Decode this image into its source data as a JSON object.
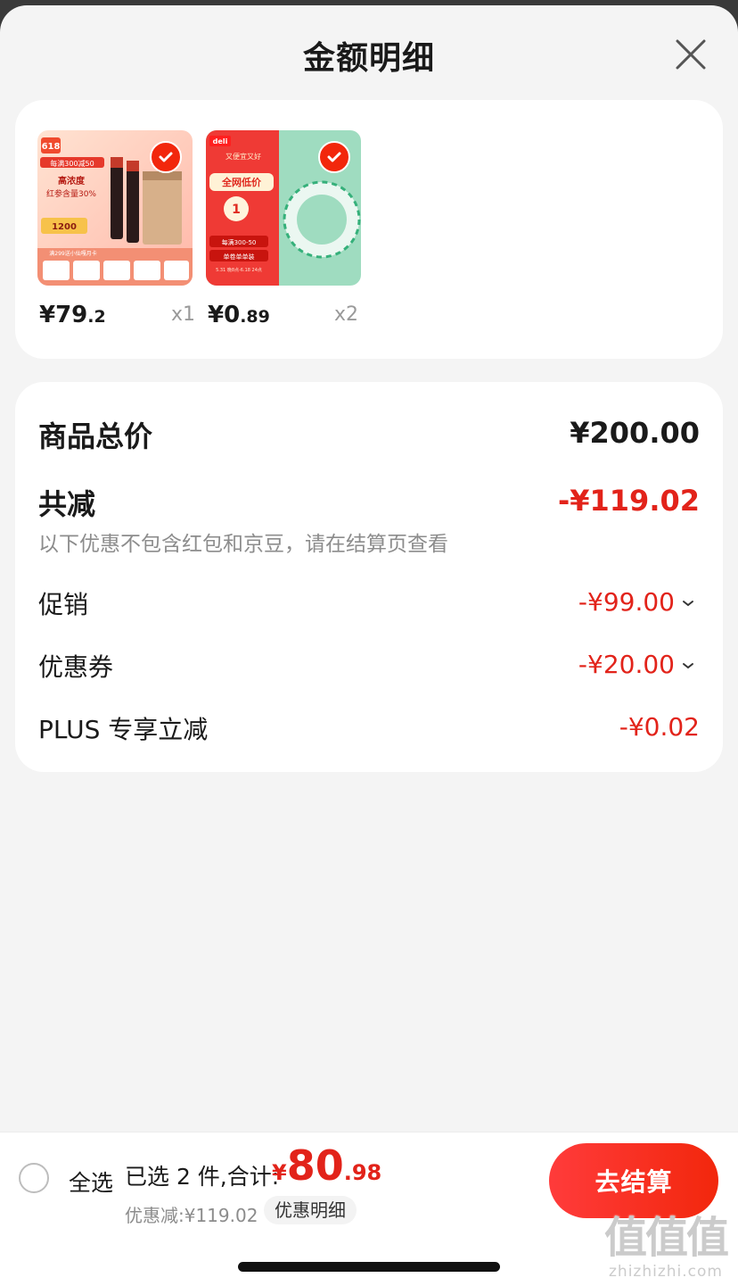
{
  "header": {
    "title": "金额明细",
    "close_icon": "close-icon"
  },
  "products": [
    {
      "price_int": "¥79",
      "price_dec": ".2",
      "quantity": "x1",
      "selected": true,
      "thumb_texts": {
        "badge": "618",
        "promo": "每满300减50",
        "line1": "高浓度",
        "line2": "红参含量30%",
        "price": "1200",
        "bottom": "满299送小仙嘎月卡"
      }
    },
    {
      "price_int": "¥0",
      "price_dec": ".89",
      "quantity": "x2",
      "selected": true,
      "thumb_texts": {
        "brand": "deli",
        "tagline": "又便宜又好",
        "headline": "全网低价",
        "number": "1",
        "promo": "每满300-50",
        "sub": "单卷单单装",
        "date": "5.31 晚8点-6.18 24点"
      }
    }
  ],
  "summary": {
    "total_label": "商品总价",
    "total_value": "¥200.00",
    "reduce_label": "共减",
    "reduce_value": "-¥119.02",
    "note": "以下优惠不包含红包和京豆，请在结算页查看",
    "promo_label": "促销",
    "promo_value": "-¥99.00",
    "coupon_label": "优惠券",
    "coupon_value": "-¥20.00",
    "plus_label": "PLUS 专享立减",
    "plus_value": "-¥0.02"
  },
  "footer": {
    "select_all": "全选",
    "selected_text": "已选 2 件,合计:",
    "total_currency": "¥",
    "total_int": "80",
    "total_dec": ".98",
    "discount_text": "优惠减:¥119.02",
    "detail_tag": "优惠明细",
    "checkout": "去结算"
  },
  "watermark": {
    "logo": "值值值",
    "url": "zhizhizhi.com"
  },
  "colors": {
    "accent_red": "#e2231a",
    "checkout_red": "#f2270c",
    "background": "#f4f4f4"
  }
}
